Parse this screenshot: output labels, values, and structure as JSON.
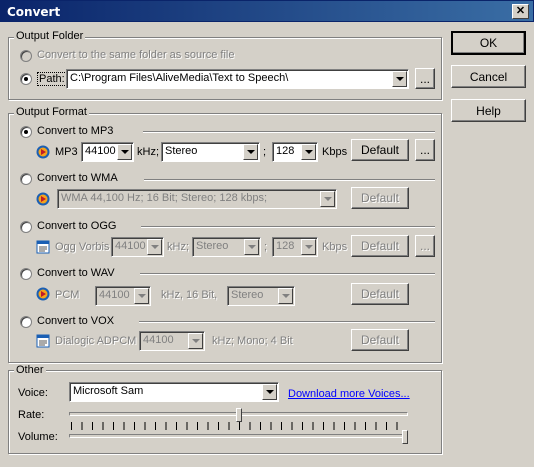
{
  "window": {
    "title": "Convert",
    "close": "✕"
  },
  "buttons": {
    "ok": "OK",
    "cancel": "Cancel",
    "help": "Help"
  },
  "output_folder": {
    "label": "Output Folder",
    "same_folder": "Convert to the same folder as source file",
    "path_label": "Path:",
    "path_value": "C:\\Program Files\\AliveMedia\\Text to Speech\\",
    "browse": "..."
  },
  "output_format": {
    "label": "Output Format",
    "mp3": {
      "radio": "Convert to MP3",
      "codec": "MP3",
      "rate": "44100",
      "khz": "kHz;",
      "channels": "Stereo",
      "sep": ";",
      "bitrate": "128",
      "kbps": "Kbps",
      "default": "Default",
      "more": "..."
    },
    "wma": {
      "radio": "Convert to WMA",
      "profile": "WMA 44,100 Hz; 16 Bit; Stereo; 128 kbps;",
      "default": "Default"
    },
    "ogg": {
      "radio": "Convert to OGG",
      "codec": "Ogg Vorbis",
      "rate": "44100",
      "khz": "kHz;",
      "channels": "Stereo",
      "sep": ";",
      "bitrate": "128",
      "kbps": "Kbps",
      "default": "Default",
      "more": "..."
    },
    "wav": {
      "radio": "Convert to WAV",
      "codec": "PCM",
      "rate": "44100",
      "khz": "kHz, 16 Bit,",
      "channels": "Stereo",
      "default": "Default"
    },
    "vox": {
      "radio": "Convert to VOX",
      "codec": "Dialogic ADPCM",
      "rate": "44100",
      "info": "kHz; Mono; 4 Bit",
      "default": "Default"
    }
  },
  "other": {
    "label": "Other",
    "voice_label": "Voice:",
    "voice_value": "Microsoft Sam",
    "download_link": "Download more Voices...",
    "rate_label": "Rate:",
    "rate_level": 0.5,
    "volume_label": "Volume:",
    "volume_level": 1.0
  }
}
